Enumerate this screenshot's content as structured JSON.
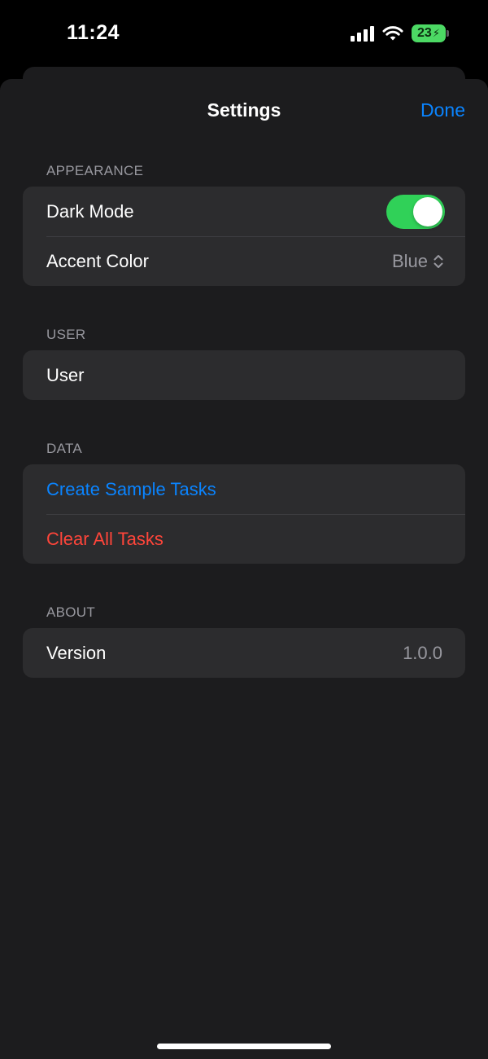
{
  "status_bar": {
    "time": "11:24",
    "battery": "23"
  },
  "nav": {
    "title": "Settings",
    "done_label": "Done"
  },
  "sections": {
    "appearance": {
      "header": "APPEARANCE",
      "dark_mode_label": "Dark Mode",
      "dark_mode_on": true,
      "accent_label": "Accent Color",
      "accent_value": "Blue"
    },
    "user": {
      "header": "USER",
      "user_label": "User"
    },
    "data": {
      "header": "DATA",
      "create_label": "Create Sample Tasks",
      "clear_label": "Clear All Tasks"
    },
    "about": {
      "header": "ABOUT",
      "version_label": "Version",
      "version_value": "1.0.0"
    }
  },
  "colors": {
    "accent": "#0a84ff",
    "destructive": "#ff453a",
    "toggle_on": "#30d158",
    "battery": "#4cd964"
  },
  "icons": [
    "cellular-signal-icon",
    "wifi-icon",
    "battery-charging-icon",
    "chevron-updown-icon"
  ]
}
